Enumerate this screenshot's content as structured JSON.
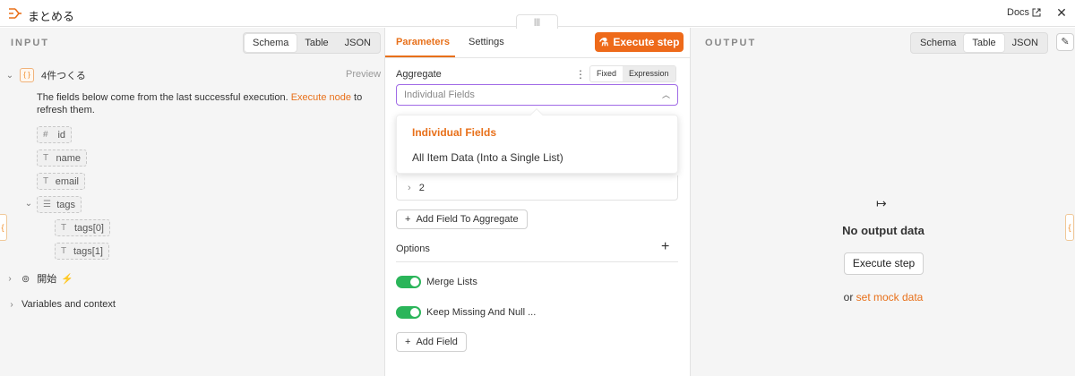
{
  "header": {
    "title": "まとめる",
    "docs_label": "Docs",
    "close_glyph": "✕",
    "node_icon": "aggregate-icon",
    "accent_color": "#e8701a"
  },
  "input": {
    "section_label": "INPUT",
    "view_tabs": [
      "Schema",
      "Table",
      "JSON"
    ],
    "active_view": "Schema",
    "node_name": "4件つくる",
    "preview_label": "Preview",
    "hint_before": "The fields below come from the last successful execution.",
    "hint_link": "Execute node",
    "hint_after": "to refresh them.",
    "fields": {
      "id": "id",
      "name": "name",
      "email": "email",
      "tags": "tags",
      "tags0": "tags[0]",
      "tags1": "tags[1]"
    },
    "trigger_node": "開始",
    "variables_label": "Variables and context"
  },
  "params": {
    "tabs": [
      "Parameters",
      "Settings"
    ],
    "active_tab": "Parameters",
    "execute_label": "Execute step",
    "aggregate_label": "Aggregate",
    "mode_fixed": "Fixed",
    "mode_expression": "Expression",
    "select_value": "Individual Fields",
    "dropdown_options": [
      "Individual Fields",
      "All Item Data (Into a Single List)"
    ],
    "collapsed_item": "2",
    "add_field_aggregate": "Add Field To Aggregate",
    "options_label": "Options",
    "toggles": [
      {
        "label": "Merge Lists",
        "on": true
      },
      {
        "label": "Keep Missing And Null ...",
        "on": true
      }
    ],
    "add_field": "Add Field"
  },
  "output": {
    "section_label": "OUTPUT",
    "view_tabs": [
      "Schema",
      "Table",
      "JSON"
    ],
    "active_view": "Table",
    "empty_title": "No output data",
    "execute_label": "Execute step",
    "mock_prefix": "or",
    "mock_link": "set mock data"
  }
}
